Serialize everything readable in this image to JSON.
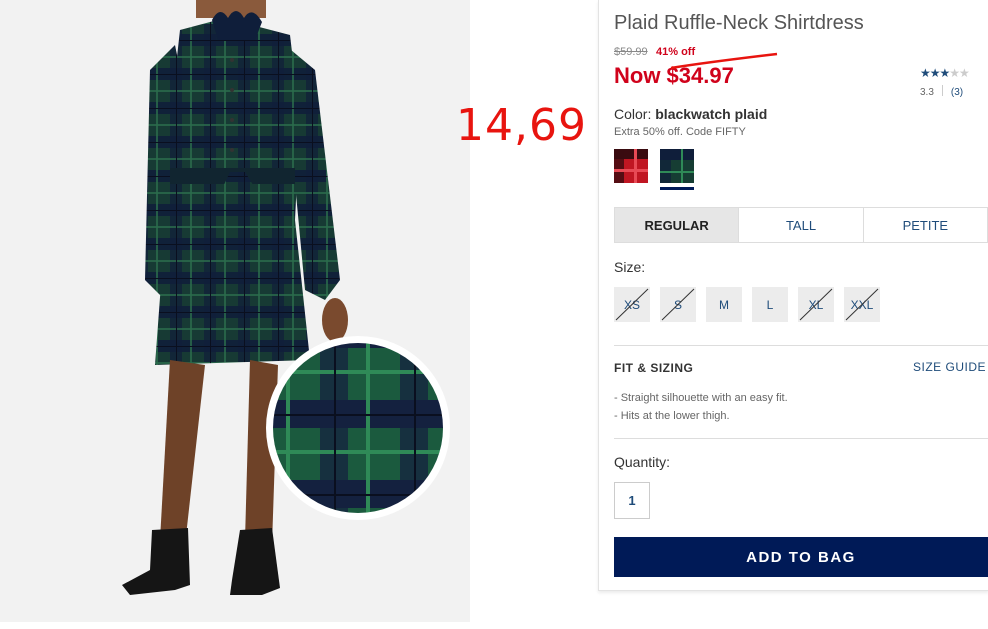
{
  "annotation": {
    "text": "14,69",
    "color": "#e8140f"
  },
  "product": {
    "title": "Plaid Ruffle-Neck Shirtdress",
    "was_price": "$59.99",
    "discount": "41% off",
    "now_price": "Now $34.97",
    "rating": {
      "stars": "3.3 of 5",
      "score": "3.3",
      "review_count": "(3)"
    }
  },
  "color": {
    "label": "Color:",
    "value": "blackwatch plaid",
    "promo": "Extra 50% off. Code FIFTY",
    "swatches": [
      {
        "name": "red plaid",
        "selected": false
      },
      {
        "name": "blackwatch plaid",
        "selected": true
      }
    ]
  },
  "fit_tabs": [
    "REGULAR",
    "TALL",
    "PETITE"
  ],
  "size": {
    "label": "Size:",
    "options": [
      {
        "label": "XS",
        "available": false
      },
      {
        "label": "S",
        "available": false
      },
      {
        "label": "M",
        "available": true
      },
      {
        "label": "L",
        "available": true
      },
      {
        "label": "XL",
        "available": false
      },
      {
        "label": "XXL",
        "available": false
      }
    ]
  },
  "fit_sizing": {
    "title": "FIT & SIZING",
    "guide_link": "SIZE GUIDE",
    "bullets": [
      "- Straight silhouette with an easy fit.",
      "- Hits at the lower thigh."
    ]
  },
  "quantity": {
    "label": "Quantity:",
    "value": "1"
  },
  "add_to_bag": "ADD TO BAG",
  "colors": {
    "navy": "#001a57",
    "sale_red": "#d0021b",
    "link_blue": "#1f4c7a"
  }
}
